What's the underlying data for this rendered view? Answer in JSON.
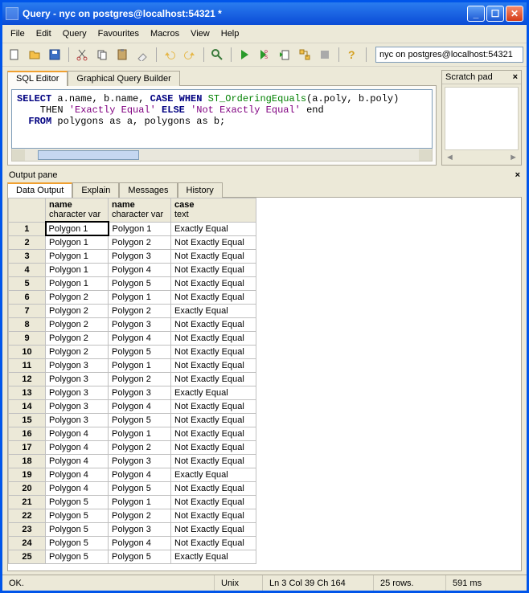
{
  "window": {
    "title": "Query - nyc on postgres@localhost:54321 *"
  },
  "menu": [
    "File",
    "Edit",
    "Query",
    "Favourites",
    "Macros",
    "View",
    "Help"
  ],
  "connection": "nyc on postgres@localhost:54321",
  "editor_tabs": {
    "sql": "SQL Editor",
    "gqb": "Graphical Query Builder"
  },
  "scratch": {
    "title": "Scratch pad"
  },
  "sql": {
    "l1a": "SELECT",
    "l1b": " a.name, b.name, ",
    "l1c": "CASE WHEN",
    "l1d": " ST_OrderingEquals",
    "l1e": "(a.poly, b.poly)",
    "l2a": "    THEN ",
    "l2b": "'Exactly Equal'",
    "l2c": " ELSE ",
    "l2d": "'Not Exactly Equal'",
    "l2e": " end",
    "l3a": "  FROM",
    "l3b": " polygons as a, polygons as b;"
  },
  "output": {
    "pane_title": "Output pane",
    "tabs": {
      "data": "Data Output",
      "explain": "Explain",
      "messages": "Messages",
      "history": "History"
    },
    "headers": [
      {
        "n": "name",
        "t": "character var"
      },
      {
        "n": "name",
        "t": "character var"
      },
      {
        "n": "case",
        "t": "text"
      }
    ],
    "rows": [
      [
        "Polygon 1",
        "Polygon 1",
        "Exactly Equal"
      ],
      [
        "Polygon 1",
        "Polygon 2",
        "Not Exactly Equal"
      ],
      [
        "Polygon 1",
        "Polygon 3",
        "Not Exactly Equal"
      ],
      [
        "Polygon 1",
        "Polygon 4",
        "Not Exactly Equal"
      ],
      [
        "Polygon 1",
        "Polygon 5",
        "Not Exactly Equal"
      ],
      [
        "Polygon 2",
        "Polygon 1",
        "Not Exactly Equal"
      ],
      [
        "Polygon 2",
        "Polygon 2",
        "Exactly Equal"
      ],
      [
        "Polygon 2",
        "Polygon 3",
        "Not Exactly Equal"
      ],
      [
        "Polygon 2",
        "Polygon 4",
        "Not Exactly Equal"
      ],
      [
        "Polygon 2",
        "Polygon 5",
        "Not Exactly Equal"
      ],
      [
        "Polygon 3",
        "Polygon 1",
        "Not Exactly Equal"
      ],
      [
        "Polygon 3",
        "Polygon 2",
        "Not Exactly Equal"
      ],
      [
        "Polygon 3",
        "Polygon 3",
        "Exactly Equal"
      ],
      [
        "Polygon 3",
        "Polygon 4",
        "Not Exactly Equal"
      ],
      [
        "Polygon 3",
        "Polygon 5",
        "Not Exactly Equal"
      ],
      [
        "Polygon 4",
        "Polygon 1",
        "Not Exactly Equal"
      ],
      [
        "Polygon 4",
        "Polygon 2",
        "Not Exactly Equal"
      ],
      [
        "Polygon 4",
        "Polygon 3",
        "Not Exactly Equal"
      ],
      [
        "Polygon 4",
        "Polygon 4",
        "Exactly Equal"
      ],
      [
        "Polygon 4",
        "Polygon 5",
        "Not Exactly Equal"
      ],
      [
        "Polygon 5",
        "Polygon 1",
        "Not Exactly Equal"
      ],
      [
        "Polygon 5",
        "Polygon 2",
        "Not Exactly Equal"
      ],
      [
        "Polygon 5",
        "Polygon 3",
        "Not Exactly Equal"
      ],
      [
        "Polygon 5",
        "Polygon 4",
        "Not Exactly Equal"
      ],
      [
        "Polygon 5",
        "Polygon 5",
        "Exactly Equal"
      ]
    ]
  },
  "status": {
    "ok": "OK.",
    "unix": "Unix",
    "pos": "Ln 3 Col 39 Ch 164",
    "rows": "25 rows.",
    "time": "591 ms"
  }
}
